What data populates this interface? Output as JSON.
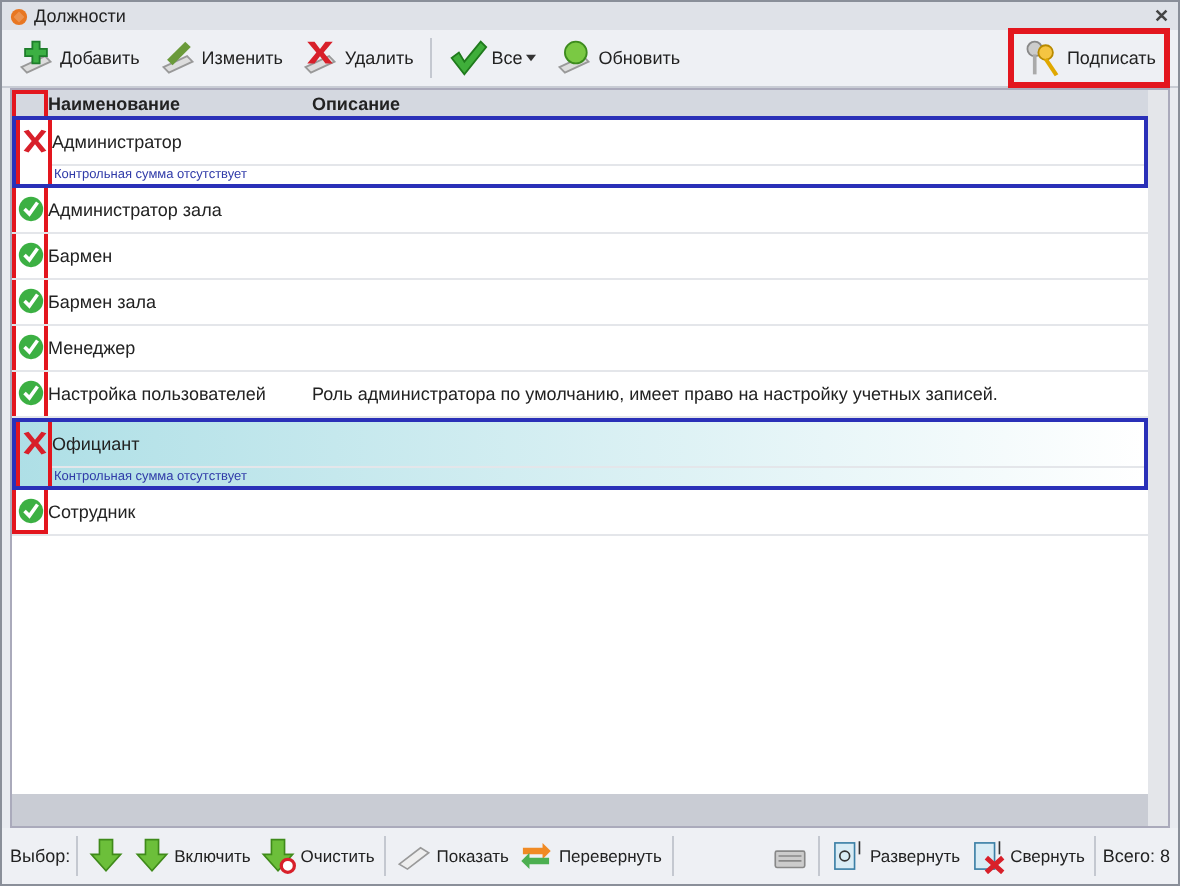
{
  "window": {
    "title": "Должности",
    "close": "✕"
  },
  "toolbar": {
    "buttons": [
      {
        "label": "Добавить",
        "kind": "add"
      },
      {
        "label": "Изменить",
        "kind": "edit"
      },
      {
        "label": "Удалить",
        "kind": "delete"
      },
      {
        "label": "Все",
        "kind": "check",
        "dropdown": true
      },
      {
        "label": "Обновить",
        "kind": "refresh"
      }
    ],
    "sign_button": {
      "label": "Подписать",
      "highlighted": true
    }
  },
  "table": {
    "columns": [
      "Наименование",
      "Описание"
    ],
    "icon_column_highlighted": true,
    "rows": [
      {
        "name": "Администратор",
        "description": "",
        "valid": false,
        "selected": false,
        "warning": "Контрольная сумма отсутствует",
        "highlighted": true
      },
      {
        "name": "Администратор зала",
        "description": "",
        "valid": true,
        "selected": false,
        "highlighted": false
      },
      {
        "name": "Бармен",
        "description": "",
        "valid": true,
        "selected": false,
        "highlighted": false
      },
      {
        "name": "Бармен зала",
        "description": "",
        "valid": true,
        "selected": false,
        "highlighted": false
      },
      {
        "name": "Менеджер",
        "description": "",
        "valid": true,
        "selected": false,
        "highlighted": false
      },
      {
        "name": "Настройка пользователей",
        "description": "Роль администратора по умолчанию, имеет право на настройку учетных записей.",
        "valid": true,
        "selected": false,
        "highlighted": false
      },
      {
        "name": "Официант",
        "description": "",
        "valid": false,
        "selected": true,
        "warning": "Контрольная сумма отсутствует",
        "highlighted": true
      },
      {
        "name": "Сотрудник",
        "description": "",
        "valid": true,
        "selected": false,
        "highlighted": false
      }
    ]
  },
  "bottom_bar": {
    "label": "Выбор:",
    "buttons": [
      {
        "kind": "down"
      },
      {
        "label": "Включить",
        "kind": "include"
      },
      {
        "label": "Очистить",
        "kind": "clear"
      },
      {
        "label": "Показать",
        "kind": "show"
      },
      {
        "label": "Перевернуть",
        "kind": "invert"
      },
      {
        "kind": "keyboard"
      },
      {
        "label": "Развернуть",
        "kind": "expand"
      },
      {
        "label": "Свернуть",
        "kind": "collapse"
      }
    ],
    "total": "Всего: 8"
  }
}
